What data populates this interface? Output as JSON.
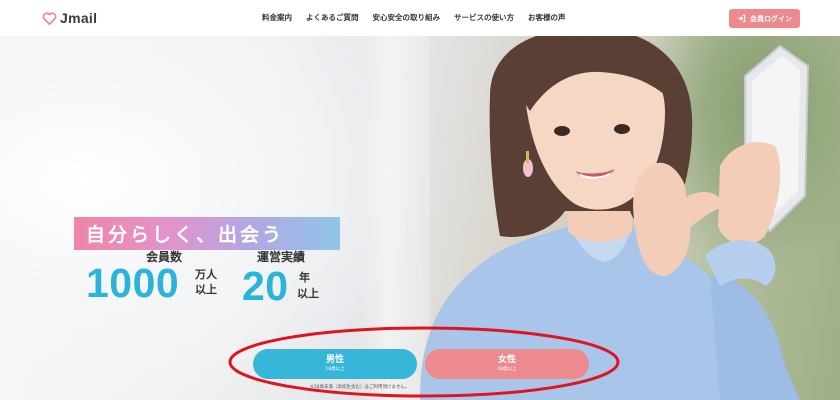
{
  "header": {
    "logo_text": "Jmail",
    "nav": [
      {
        "label": "料金案内"
      },
      {
        "label": "よくあるご質問"
      },
      {
        "label": "安心安全の取り組み"
      },
      {
        "label": "サービスの使い方"
      },
      {
        "label": "お客様の声"
      }
    ],
    "login_label": "会員ログイン"
  },
  "hero": {
    "tagline": "自分らしく、出会う",
    "stats": [
      {
        "label": "会員数",
        "number": "1000",
        "unit_top": "万人",
        "unit_bottom": "以上"
      },
      {
        "label": "運営実績",
        "number": "20",
        "unit_top": "年",
        "unit_bottom": "以上"
      }
    ]
  },
  "cta": {
    "male": {
      "label": "男性",
      "sub": "18歳以上"
    },
    "female": {
      "label": "女性",
      "sub": "18歳以上"
    }
  },
  "note": "※18歳未満（高校生含む）はご利用頂けません。",
  "colors": {
    "accent_blue": "#2bb4d8",
    "accent_pink": "#ec8a8e",
    "annotation_red": "#e0141e"
  },
  "icons": {
    "logo": "heart-icon",
    "login": "login-arrow-icon"
  }
}
